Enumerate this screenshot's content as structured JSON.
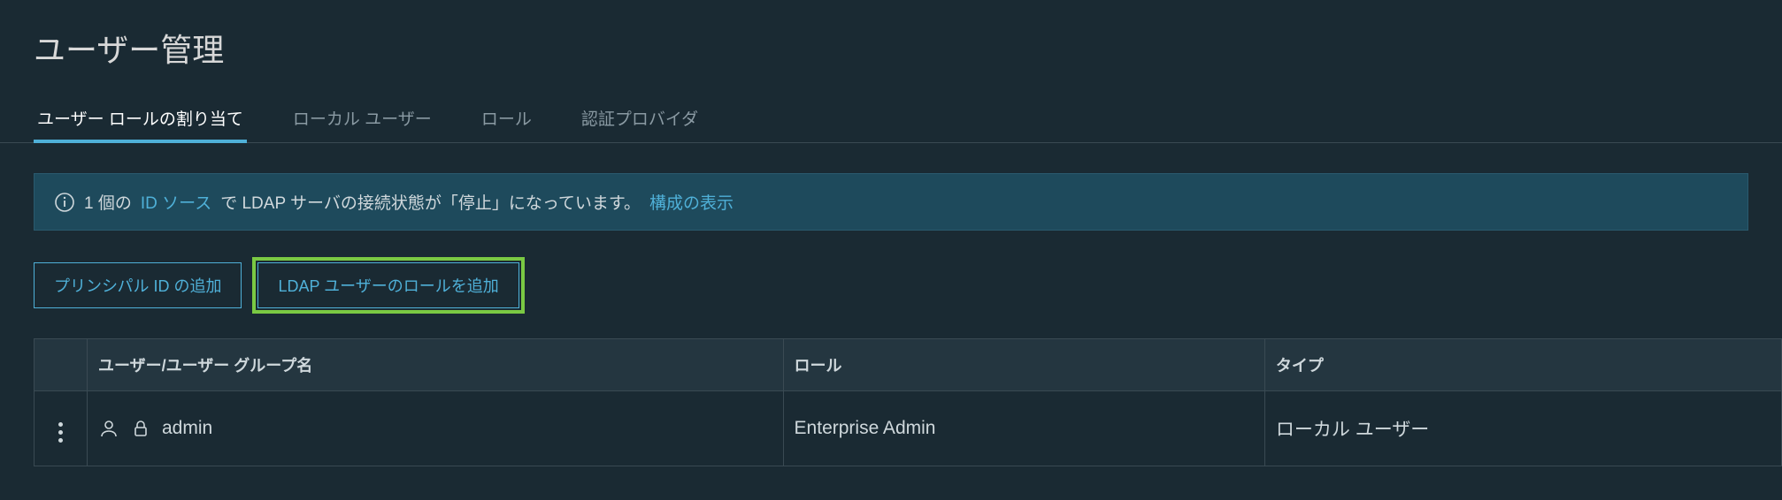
{
  "page": {
    "title": "ユーザー管理"
  },
  "tabs": {
    "t0": "ユーザー ロールの割り当て",
    "t1": "ローカル ユーザー",
    "t2": "ロール",
    "t3": "認証プロバイダ"
  },
  "info": {
    "prefix": "1 個の ",
    "link1": "ID ソース",
    "mid": " で LDAP サーバの接続状態が「停止」になっています。 ",
    "link2": "構成の表示"
  },
  "buttons": {
    "add_principal": "プリンシパル ID の追加",
    "add_ldap_role": "LDAP ユーザーのロールを追加"
  },
  "table": {
    "headers": {
      "name": "ユーザー/ユーザー グループ名",
      "role": "ロール",
      "type": "タイプ"
    },
    "rows": {
      "r0": {
        "name": "admin",
        "role": "Enterprise Admin",
        "type": "ローカル ユーザー"
      }
    }
  }
}
